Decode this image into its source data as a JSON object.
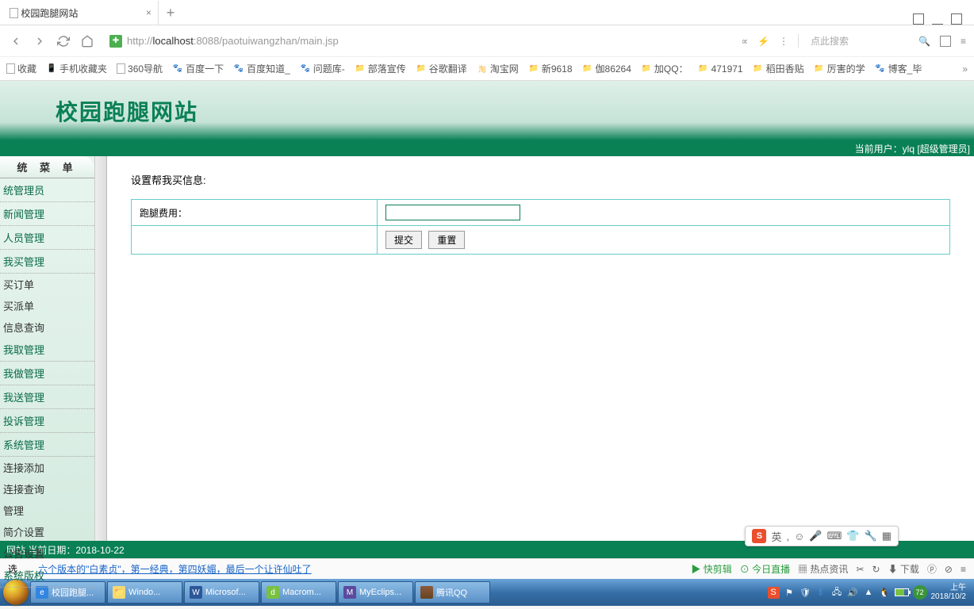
{
  "tab": {
    "title": "校园跑腿网站"
  },
  "url": {
    "pre": "http://",
    "host": "localhost",
    "rest": ":8088/paotuiwangzhan/main.jsp"
  },
  "search_placeholder": "点此搜索",
  "bookmarks": [
    "收藏",
    "手机收藏夹",
    "360导航",
    "百度一下",
    "百度知道_",
    "问题库-",
    "部落宣传",
    "谷歌翻译",
    "淘宝网",
    "新9618",
    "伽86264",
    "加QQ：",
    "471971",
    "稻田香贴",
    "厉害的学",
    "博客_毕"
  ],
  "site_title": "校园跑腿网站",
  "user_info": "当前用户：ylq [超级管理员]",
  "sidebar_header": "统 菜 单",
  "menu": [
    {
      "type": "cat",
      "label": "统管理员"
    },
    {
      "type": "cat",
      "label": "新闻管理"
    },
    {
      "type": "cat",
      "label": "人员管理"
    },
    {
      "type": "cat",
      "label": "我买管理"
    },
    {
      "type": "item",
      "label": "买订单"
    },
    {
      "type": "item",
      "label": "买派单"
    },
    {
      "type": "item",
      "label": "信息查询"
    },
    {
      "type": "cat",
      "label": "我取管理"
    },
    {
      "type": "cat",
      "label": "我做管理"
    },
    {
      "type": "cat",
      "label": "我送管理"
    },
    {
      "type": "cat",
      "label": "投诉管理"
    },
    {
      "type": "cat",
      "label": "系统管理"
    },
    {
      "type": "item",
      "label": "连接添加"
    },
    {
      "type": "item",
      "label": "连接查询"
    },
    {
      "type": "item",
      "label": "管理"
    },
    {
      "type": "item",
      "label": "简介设置"
    },
    {
      "type": "item",
      "label": "公告设置"
    },
    {
      "type": "cat",
      "label": "系统版权"
    }
  ],
  "form": {
    "heading": "设置帮我买信息:",
    "fee_label": "跑腿费用：",
    "fee_value": "",
    "submit": "提交",
    "reset": "重置"
  },
  "footer": "网站 当前日期：2018-10-22",
  "ime_lang": "英",
  "news_link": "六个版本的\"白素贞\"，第一经典，第四妖媚，最后一个让许仙吐了",
  "status_items": [
    "快剪辑",
    "今日直播",
    "热点资讯",
    "下载"
  ],
  "sel_label": "选",
  "tasks": [
    "校园跑腿...",
    "Windo...",
    "Microsof...",
    "Macrom...",
    "MyEclips...",
    "腾讯QQ"
  ],
  "battery_pct": "72",
  "clock": {
    "top": "上午",
    "bottom": "2018/10/2"
  }
}
